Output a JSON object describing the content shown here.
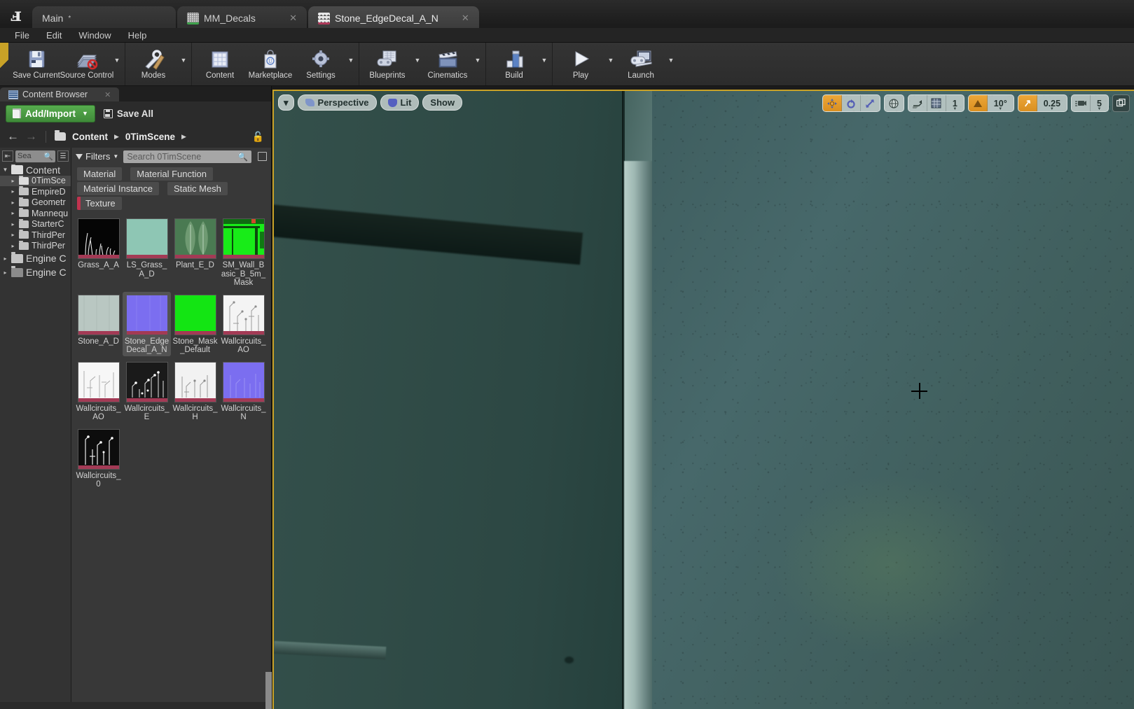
{
  "window": {
    "logo": "unreal-logo",
    "tabs": [
      {
        "label": "Main",
        "modified": "*",
        "icon": "none",
        "active": false,
        "closable": false
      },
      {
        "label": "MM_Decals",
        "icon": "blueprint-icon",
        "active": false,
        "closable": true
      },
      {
        "label": "Stone_EdgeDecal_A_N",
        "icon": "texture-icon",
        "active": true,
        "closable": true
      }
    ]
  },
  "menubar": {
    "items": [
      "File",
      "Edit",
      "Window",
      "Help"
    ]
  },
  "toolbar": {
    "groups": [
      {
        "buttons": [
          {
            "label": "Save Current",
            "icon": "floppy-disk-icon",
            "caret": false
          },
          {
            "label": "Source Control",
            "icon": "source-control-icon",
            "caret": true
          }
        ]
      },
      {
        "buttons": [
          {
            "label": "Modes",
            "icon": "modes-wrench-icon",
            "caret": true
          }
        ]
      },
      {
        "buttons": [
          {
            "label": "Content",
            "icon": "content-grid-icon",
            "caret": false
          },
          {
            "label": "Marketplace",
            "icon": "marketplace-bag-icon",
            "caret": false
          },
          {
            "label": "Settings",
            "icon": "settings-gear-icon",
            "caret": true
          }
        ]
      },
      {
        "buttons": [
          {
            "label": "Blueprints",
            "icon": "blueprints-icon",
            "caret": true
          },
          {
            "label": "Cinematics",
            "icon": "cinematics-clapper-icon",
            "caret": true
          }
        ]
      },
      {
        "buttons": [
          {
            "label": "Build",
            "icon": "build-icon",
            "caret": true
          }
        ]
      },
      {
        "buttons": [
          {
            "label": "Play",
            "icon": "play-triangle-icon",
            "caret": true
          },
          {
            "label": "Launch",
            "icon": "launch-gamepad-icon",
            "caret": true
          }
        ]
      }
    ]
  },
  "content_browser": {
    "tab_label": "Content Browser",
    "tab_icon": "content-browser-icon",
    "add_import_label": "Add/Import",
    "save_all_label": "Save All",
    "breadcrumb": {
      "root": "Content",
      "current": "0TimScene"
    },
    "sources": {
      "search_placeholder": "Sea",
      "tree": [
        {
          "label": "Content",
          "depth": 0,
          "expanded": true,
          "selected": false,
          "big": true
        },
        {
          "label": "0TimSce",
          "depth": 1,
          "expanded": false,
          "selected": true
        },
        {
          "label": "EmpireD",
          "depth": 1,
          "expanded": false,
          "selected": false
        },
        {
          "label": "Geometr",
          "depth": 1,
          "expanded": false,
          "selected": false
        },
        {
          "label": "Mannequ",
          "depth": 1,
          "expanded": false,
          "selected": false
        },
        {
          "label": "StarterC",
          "depth": 1,
          "expanded": false,
          "selected": false
        },
        {
          "label": "ThirdPer",
          "depth": 1,
          "expanded": false,
          "selected": false
        },
        {
          "label": "ThirdPer",
          "depth": 1,
          "expanded": false,
          "selected": false
        },
        {
          "label": "Engine C",
          "depth": 0,
          "expanded": false,
          "selected": false,
          "big": true
        },
        {
          "label": "Engine C",
          "depth": 0,
          "expanded": false,
          "selected": false,
          "big": true
        }
      ]
    },
    "filters_label": "Filters",
    "search_placeholder": "Search 0TimScene",
    "filter_pills": [
      {
        "label": "Material",
        "color": ""
      },
      {
        "label": "Material Function",
        "color": ""
      },
      {
        "label": "Material Instance",
        "color": ""
      },
      {
        "label": "Static Mesh",
        "color": ""
      },
      {
        "label": "Texture",
        "color": "#c0334f"
      }
    ],
    "assets": [
      {
        "name": "Grass_A_A",
        "thumb": "t-grass",
        "selected": false
      },
      {
        "name": "LS_Grass_A_D",
        "thumb": "t-lsgrass",
        "selected": false
      },
      {
        "name": "Plant_E_D",
        "thumb": "t-plant",
        "selected": false
      },
      {
        "name": "SM_Wall_Basic_B_5m_Mask",
        "thumb": "t-wallmask",
        "selected": false
      },
      {
        "name": "Stone_A_D",
        "thumb": "t-stonead",
        "selected": false
      },
      {
        "name": "Stone_Edge Decal_A_N",
        "thumb": "t-edgedecal",
        "selected": true
      },
      {
        "name": "Stone_Mask _Default",
        "thumb": "t-stonemask",
        "selected": false
      },
      {
        "name": "Wallcircuits_AO",
        "thumb": "t-wcwhite",
        "selected": false
      },
      {
        "name": "Wallcircuits_AO",
        "thumb": "t-wcwhite",
        "selected": false
      },
      {
        "name": "Wallcircuits_E",
        "thumb": "t-wcblack",
        "selected": false
      },
      {
        "name": "Wallcircuits_H",
        "thumb": "t-wcwhite",
        "selected": false
      },
      {
        "name": "Wallcircuits_N",
        "thumb": "t-wcblue",
        "selected": false
      },
      {
        "name": "Wallcircuits_0",
        "thumb": "t-wcblack",
        "selected": false
      }
    ]
  },
  "viewport": {
    "left_controls": {
      "menu_caret": "▾",
      "camera_label": "Perspective",
      "shading_label": "Lit",
      "show_label": "Show"
    },
    "right_controls": {
      "translate_icon": "translate-gizmo-icon",
      "rotate_icon": "rotate-gizmo-icon",
      "scale_icon": "scale-gizmo-icon",
      "coord_icon": "world-coordinate-icon",
      "surface_snap_icon": "surface-snap-icon",
      "grid_snap_icon": "grid-snap-icon",
      "grid_value": "1",
      "rotation_snap_icon": "rotation-snap-icon",
      "rotation_value": "10°",
      "scale_snap_icon": "scale-snap-icon",
      "scale_value": "0.25",
      "camera_speed_icon": "camera-speed-icon",
      "camera_speed_value": "5",
      "maximize_icon": "maximize-viewport-icon"
    }
  }
}
